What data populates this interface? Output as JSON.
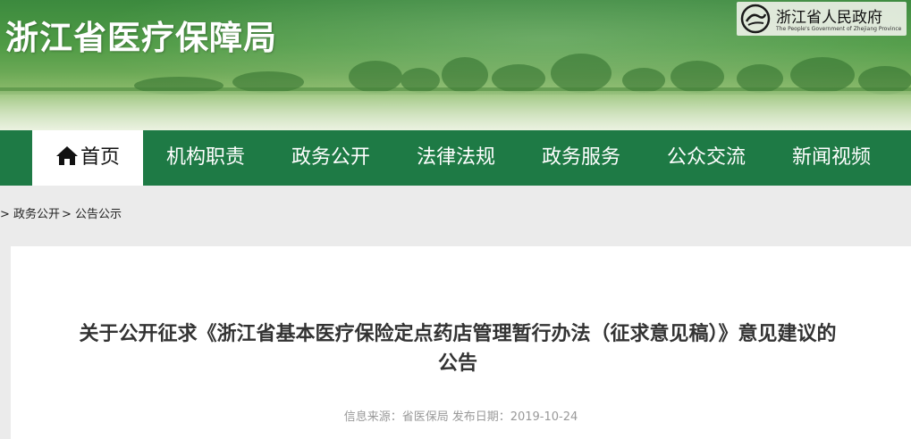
{
  "header": {
    "site_title": "浙江省医疗保障局",
    "gov_logo": {
      "name": "浙江省人民政府",
      "english": "The People's Government of Zhejiang Province",
      "icon": "zhejiang-emblem-icon"
    },
    "colors": {
      "nav_bg": "#1e7a45",
      "title": "#ffffff"
    }
  },
  "nav": {
    "items": [
      {
        "label": "首页",
        "active": true,
        "icon": "home-icon"
      },
      {
        "label": "机构职责"
      },
      {
        "label": "政务公开"
      },
      {
        "label": "法律法规"
      },
      {
        "label": "政务服务"
      },
      {
        "label": "公众交流"
      },
      {
        "label": "新闻视频"
      }
    ]
  },
  "breadcrumb": {
    "items": [
      "> 政务公开",
      "> 公告公示"
    ]
  },
  "article": {
    "title": "关于公开征求《浙江省基本医疗保险定点药店管理暂行办法（征求意见稿）》意见建议的公告",
    "source": "信息来源：省医保局",
    "date": "发布日期：2019-10-24"
  }
}
